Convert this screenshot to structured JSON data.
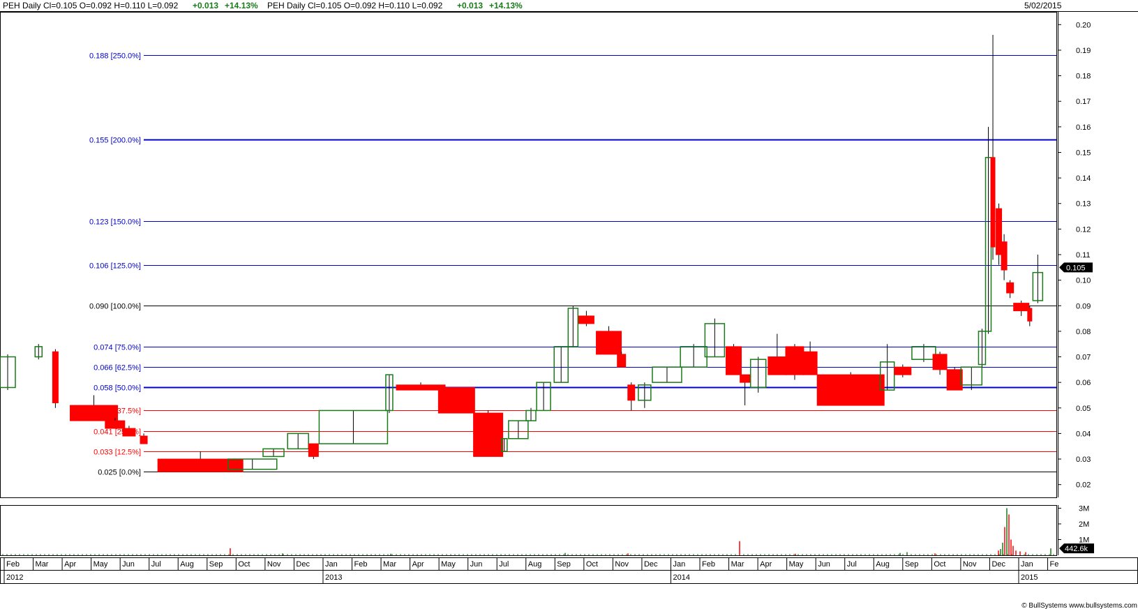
{
  "header": {
    "left_text": "PEH  Daily   Cl=0.105  O=0.092  H=0.110  L=0.092",
    "left_change": "+0.013",
    "left_pct": "+14.13%",
    "mid_text": "PEH  Daily   Cl=0.105  O=0.092  H=0.110  L=0.092",
    "mid_change": "+0.013",
    "mid_pct": "+14.13%",
    "date": "5/02/2015"
  },
  "footer": {
    "credit": "© BullSystems www.bullsystems.com"
  },
  "colors": {
    "up": "#1a7a1a",
    "down": "#ff0000",
    "fib_blue": "#0000cc",
    "fib_red": "#ff0000",
    "fib_black": "#000000",
    "grid": "#e0e0e0"
  },
  "chart_data": {
    "type": "candlestick-equivolume",
    "title": "PEH Daily",
    "ylim": [
      0.015,
      0.205
    ],
    "y_ticks": [
      "0.20",
      "0.19",
      "0.18",
      "0.17",
      "0.16",
      "0.15",
      "0.14",
      "0.13",
      "0.12",
      "0.11",
      "0.10",
      "0.09",
      "0.08",
      "0.07",
      "0.06",
      "0.05",
      "0.04",
      "0.03",
      "0.02"
    ],
    "last_price_label": "0.105",
    "last_price": 0.105,
    "fib_levels": [
      {
        "value": 0.188,
        "label": "0.188 [250.0%]",
        "color": "blue"
      },
      {
        "value": 0.155,
        "label": "0.155 [200.0%]",
        "color": "blue",
        "bold": true
      },
      {
        "value": 0.123,
        "label": "0.123 [150.0%]",
        "color": "blue"
      },
      {
        "value": 0.106,
        "label": "0.106 [125.0%]",
        "color": "blue"
      },
      {
        "value": 0.09,
        "label": "0.090 [100.0%]",
        "color": "black"
      },
      {
        "value": 0.074,
        "label": "0.074 [75.0%]",
        "color": "blue"
      },
      {
        "value": 0.066,
        "label": "0.066 [62.5%]",
        "color": "blue"
      },
      {
        "value": 0.058,
        "label": "0.058 [50.0%]",
        "color": "blue",
        "bold": true
      },
      {
        "value": 0.049,
        "label": "0.049 [37.5%]",
        "color": "red"
      },
      {
        "value": 0.041,
        "label": "0.041 [25.0%]",
        "color": "red"
      },
      {
        "value": 0.033,
        "label": "0.033 [12.5%]",
        "color": "red"
      },
      {
        "value": 0.025,
        "label": "0.025 [0.0%]",
        "color": "black"
      }
    ],
    "months": [
      "Feb",
      "Mar",
      "Apr",
      "May",
      "Jun",
      "Jul",
      "Aug",
      "Sep",
      "Oct",
      "Nov",
      "Dec",
      "Jan",
      "Feb",
      "Mar",
      "Apr",
      "May",
      "Jun",
      "Jul",
      "Aug",
      "Sep",
      "Oct",
      "Nov",
      "Dec",
      "Jan",
      "Feb",
      "Mar",
      "Apr",
      "May",
      "Jun",
      "Jul",
      "Aug",
      "Sep",
      "Oct",
      "Nov",
      "Dec",
      "Jan",
      "Fe"
    ],
    "years": [
      "2012",
      "2013",
      "2014",
      "2015"
    ],
    "volume_ticks": [
      "3M",
      "2M",
      "1M"
    ],
    "volume_last_label": "442.6k",
    "candles": [
      {
        "t": 0.0,
        "w": 22,
        "o": 0.058,
        "c": 0.07,
        "h": 0.071,
        "l": 0.057
      },
      {
        "t": 1.0,
        "w": 10,
        "o": 0.07,
        "c": 0.074,
        "h": 0.075,
        "l": 0.069
      },
      {
        "t": 1.5,
        "w": 8,
        "o": 0.072,
        "c": 0.052,
        "h": 0.073,
        "l": 0.05
      },
      {
        "t": 2.0,
        "w": 68,
        "o": 0.051,
        "c": 0.045,
        "h": 0.055,
        "l": 0.045
      },
      {
        "t": 3.0,
        "w": 28,
        "o": 0.045,
        "c": 0.042,
        "h": 0.046,
        "l": 0.042
      },
      {
        "t": 3.5,
        "w": 18,
        "o": 0.042,
        "c": 0.039,
        "h": 0.043,
        "l": 0.039
      },
      {
        "t": 4.0,
        "w": 10,
        "o": 0.039,
        "c": 0.036,
        "h": 0.04,
        "l": 0.036
      },
      {
        "t": 4.5,
        "w": 122,
        "o": 0.03,
        "c": 0.025,
        "h": 0.033,
        "l": 0.025
      },
      {
        "t": 6.5,
        "w": 70,
        "o": 0.026,
        "c": 0.03,
        "h": 0.03,
        "l": 0.026
      },
      {
        "t": 7.5,
        "w": 30,
        "o": 0.031,
        "c": 0.034,
        "h": 0.034,
        "l": 0.031
      },
      {
        "t": 8.2,
        "w": 30,
        "o": 0.034,
        "c": 0.04,
        "h": 0.04,
        "l": 0.034
      },
      {
        "t": 8.8,
        "w": 14,
        "o": 0.036,
        "c": 0.031,
        "h": 0.036,
        "l": 0.03
      },
      {
        "t": 9.1,
        "w": 98,
        "o": 0.036,
        "c": 0.049,
        "h": 0.049,
        "l": 0.036
      },
      {
        "t": 11.0,
        "w": 10,
        "o": 0.049,
        "c": 0.063,
        "h": 0.063,
        "l": 0.048
      },
      {
        "t": 11.3,
        "w": 70,
        "o": 0.059,
        "c": 0.057,
        "h": 0.06,
        "l": 0.057
      },
      {
        "t": 12.5,
        "w": 52,
        "o": 0.058,
        "c": 0.048,
        "h": 0.058,
        "l": 0.048
      },
      {
        "t": 13.5,
        "w": 42,
        "o": 0.048,
        "c": 0.031,
        "h": 0.049,
        "l": 0.031
      },
      {
        "t": 14.3,
        "w": 8,
        "o": 0.033,
        "c": 0.038,
        "h": 0.038,
        "l": 0.033
      },
      {
        "t": 14.5,
        "w": 28,
        "o": 0.038,
        "c": 0.045,
        "h": 0.045,
        "l": 0.038
      },
      {
        "t": 15.0,
        "w": 14,
        "o": 0.045,
        "c": 0.049,
        "h": 0.05,
        "l": 0.045
      },
      {
        "t": 15.3,
        "w": 20,
        "o": 0.049,
        "c": 0.06,
        "h": 0.06,
        "l": 0.049
      },
      {
        "t": 15.8,
        "w": 20,
        "o": 0.06,
        "c": 0.074,
        "h": 0.074,
        "l": 0.06
      },
      {
        "t": 16.2,
        "w": 14,
        "o": 0.074,
        "c": 0.089,
        "h": 0.09,
        "l": 0.074
      },
      {
        "t": 16.5,
        "w": 22,
        "o": 0.086,
        "c": 0.083,
        "h": 0.088,
        "l": 0.082
      },
      {
        "t": 17.0,
        "w": 36,
        "o": 0.08,
        "c": 0.071,
        "h": 0.082,
        "l": 0.071
      },
      {
        "t": 17.6,
        "w": 12,
        "o": 0.071,
        "c": 0.066,
        "h": 0.072,
        "l": 0.066
      },
      {
        "t": 17.9,
        "w": 10,
        "o": 0.059,
        "c": 0.053,
        "h": 0.06,
        "l": 0.049
      },
      {
        "t": 18.2,
        "w": 18,
        "o": 0.053,
        "c": 0.059,
        "h": 0.06,
        "l": 0.05
      },
      {
        "t": 18.6,
        "w": 42,
        "o": 0.06,
        "c": 0.066,
        "h": 0.066,
        "l": 0.06
      },
      {
        "t": 19.4,
        "w": 38,
        "o": 0.066,
        "c": 0.074,
        "h": 0.075,
        "l": 0.066
      },
      {
        "t": 20.1,
        "w": 28,
        "o": 0.07,
        "c": 0.083,
        "h": 0.085,
        "l": 0.07
      },
      {
        "t": 20.7,
        "w": 22,
        "o": 0.074,
        "c": 0.063,
        "h": 0.075,
        "l": 0.063
      },
      {
        "t": 21.1,
        "w": 14,
        "o": 0.063,
        "c": 0.06,
        "h": 0.063,
        "l": 0.051
      },
      {
        "t": 21.4,
        "w": 22,
        "o": 0.058,
        "c": 0.069,
        "h": 0.07,
        "l": 0.056
      },
      {
        "t": 21.9,
        "w": 26,
        "o": 0.07,
        "c": 0.063,
        "h": 0.079,
        "l": 0.063
      },
      {
        "t": 22.4,
        "w": 26,
        "o": 0.074,
        "c": 0.063,
        "h": 0.075,
        "l": 0.061
      },
      {
        "t": 22.9,
        "w": 20,
        "o": 0.072,
        "c": 0.063,
        "h": 0.076,
        "l": 0.063
      },
      {
        "t": 23.3,
        "w": 96,
        "o": 0.063,
        "c": 0.051,
        "h": 0.064,
        "l": 0.051
      },
      {
        "t": 25.1,
        "w": 20,
        "o": 0.057,
        "c": 0.068,
        "h": 0.075,
        "l": 0.057
      },
      {
        "t": 25.5,
        "w": 24,
        "o": 0.066,
        "c": 0.063,
        "h": 0.067,
        "l": 0.062
      },
      {
        "t": 26.0,
        "w": 34,
        "o": 0.069,
        "c": 0.074,
        "h": 0.075,
        "l": 0.068
      },
      {
        "t": 26.6,
        "w": 20,
        "o": 0.071,
        "c": 0.065,
        "h": 0.072,
        "l": 0.063
      },
      {
        "t": 27.0,
        "w": 22,
        "o": 0.065,
        "c": 0.057,
        "h": 0.066,
        "l": 0.057
      },
      {
        "t": 27.4,
        "w": 30,
        "o": 0.059,
        "c": 0.066,
        "h": 0.066,
        "l": 0.057
      },
      {
        "t": 27.9,
        "w": 10,
        "o": 0.067,
        "c": 0.08,
        "h": 0.081,
        "l": 0.066
      },
      {
        "t": 28.1,
        "w": 8,
        "o": 0.08,
        "c": 0.148,
        "h": 0.16,
        "l": 0.079
      },
      {
        "t": 28.25,
        "w": 6,
        "o": 0.148,
        "c": 0.113,
        "h": 0.196,
        "l": 0.108
      },
      {
        "t": 28.4,
        "w": 8,
        "o": 0.128,
        "c": 0.11,
        "h": 0.13,
        "l": 0.106
      },
      {
        "t": 28.55,
        "w": 8,
        "o": 0.115,
        "c": 0.104,
        "h": 0.118,
        "l": 0.1
      },
      {
        "t": 28.7,
        "w": 10,
        "o": 0.099,
        "c": 0.095,
        "h": 0.1,
        "l": 0.093
      },
      {
        "t": 28.9,
        "w": 22,
        "o": 0.091,
        "c": 0.088,
        "h": 0.092,
        "l": 0.086
      },
      {
        "t": 29.3,
        "w": 6,
        "o": 0.089,
        "c": 0.084,
        "h": 0.09,
        "l": 0.082
      },
      {
        "t": 29.45,
        "w": 14,
        "o": 0.092,
        "c": 0.103,
        "h": 0.11,
        "l": 0.091
      }
    ],
    "volumes": [
      {
        "x": 330,
        "v": 0.45,
        "c": "down"
      },
      {
        "x": 1060,
        "v": 0.9,
        "c": "down"
      },
      {
        "x": 1440,
        "v": 1.8,
        "c": "down"
      },
      {
        "x": 1443,
        "v": 3.0,
        "c": "up"
      },
      {
        "x": 1446,
        "v": 2.6,
        "c": "down"
      },
      {
        "x": 1449,
        "v": 1.0,
        "c": "down"
      },
      {
        "x": 1452,
        "v": 0.6,
        "c": "down"
      },
      {
        "x": 1437,
        "v": 0.8,
        "c": "up"
      },
      {
        "x": 1434,
        "v": 0.4,
        "c": "up"
      },
      {
        "x": 1431,
        "v": 0.3,
        "c": "down"
      },
      {
        "x": 1456,
        "v": 0.3,
        "c": "down"
      },
      {
        "x": 1462,
        "v": 0.25,
        "c": "down"
      },
      {
        "x": 1470,
        "v": 0.2,
        "c": "down"
      },
      {
        "x": 1506,
        "v": 0.44,
        "c": "up"
      },
      {
        "x": 1290,
        "v": 0.15,
        "c": "up"
      },
      {
        "x": 1300,
        "v": 0.2,
        "c": "up"
      },
      {
        "x": 1340,
        "v": 0.12,
        "c": "down"
      },
      {
        "x": 405,
        "v": 0.12,
        "c": "up"
      },
      {
        "x": 560,
        "v": 0.1,
        "c": "up"
      },
      {
        "x": 810,
        "v": 0.15,
        "c": "up"
      },
      {
        "x": 900,
        "v": 0.12,
        "c": "down"
      },
      {
        "x": 1140,
        "v": 0.1,
        "c": "down"
      }
    ]
  }
}
